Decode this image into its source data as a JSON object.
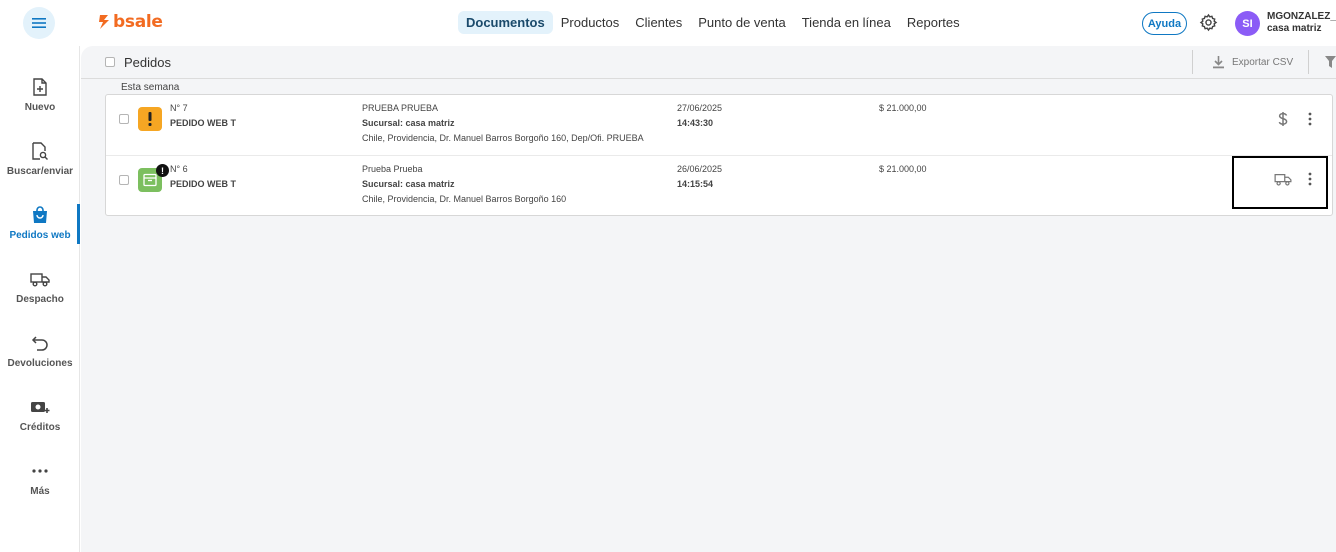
{
  "brand": {
    "name": "bsale"
  },
  "nav": {
    "items": [
      {
        "label": "Documentos",
        "active": true
      },
      {
        "label": "Productos",
        "active": false
      },
      {
        "label": "Clientes",
        "active": false
      },
      {
        "label": "Punto de venta",
        "active": false
      },
      {
        "label": "Tienda en línea",
        "active": false
      },
      {
        "label": "Reportes",
        "active": false
      }
    ]
  },
  "header": {
    "help_label": "Ayuda",
    "avatar_initials": "SI",
    "user_name": "MGONZALEZ_...",
    "user_branch": "casa matriz"
  },
  "sidebar": {
    "items": [
      {
        "label": "Nuevo",
        "icon": "file-plus-icon"
      },
      {
        "label": "Buscar/enviar",
        "icon": "file-search-icon"
      },
      {
        "label": "Pedidos web",
        "icon": "shopping-bag-icon",
        "active": true
      },
      {
        "label": "Despacho",
        "icon": "truck-icon"
      },
      {
        "label": "Devoluciones",
        "icon": "return-arrow-icon"
      },
      {
        "label": "Créditos",
        "icon": "money-plus-icon"
      },
      {
        "label": "Más",
        "icon": "more-dots-icon"
      }
    ]
  },
  "toolbar": {
    "title": "Pedidos",
    "export_label": "Exportar CSV"
  },
  "section": {
    "label": "Esta semana"
  },
  "orders": [
    {
      "number": "N° 7",
      "type": "PEDIDO WEB T",
      "client": "PRUEBA PRUEBA",
      "branch": "Sucursal: casa matriz",
      "address": "Chile, Providencia, Dr. Manuel Barros Borgoño 160, Dep/Ofi. PRUEBA",
      "date": "27/06/2025",
      "time": "14:43:30",
      "amount": "$ 21.000,00",
      "status": "warning",
      "action_icon": "dollar-icon"
    },
    {
      "number": "N° 6",
      "type": "PEDIDO WEB T",
      "client": "Prueba Prueba",
      "branch": "Sucursal: casa matriz",
      "address": "Chile, Providencia, Dr. Manuel Barros Borgoño 160",
      "date": "26/06/2025",
      "time": "14:15:54",
      "amount": "$ 21.000,00",
      "status": "ok",
      "action_icon": "truck-icon"
    }
  ],
  "colors": {
    "accent": "#0f78c3",
    "brand": "#f26b21",
    "warning": "#f6a623",
    "success": "#7cbf5f",
    "avatar": "#8b5cf6"
  }
}
